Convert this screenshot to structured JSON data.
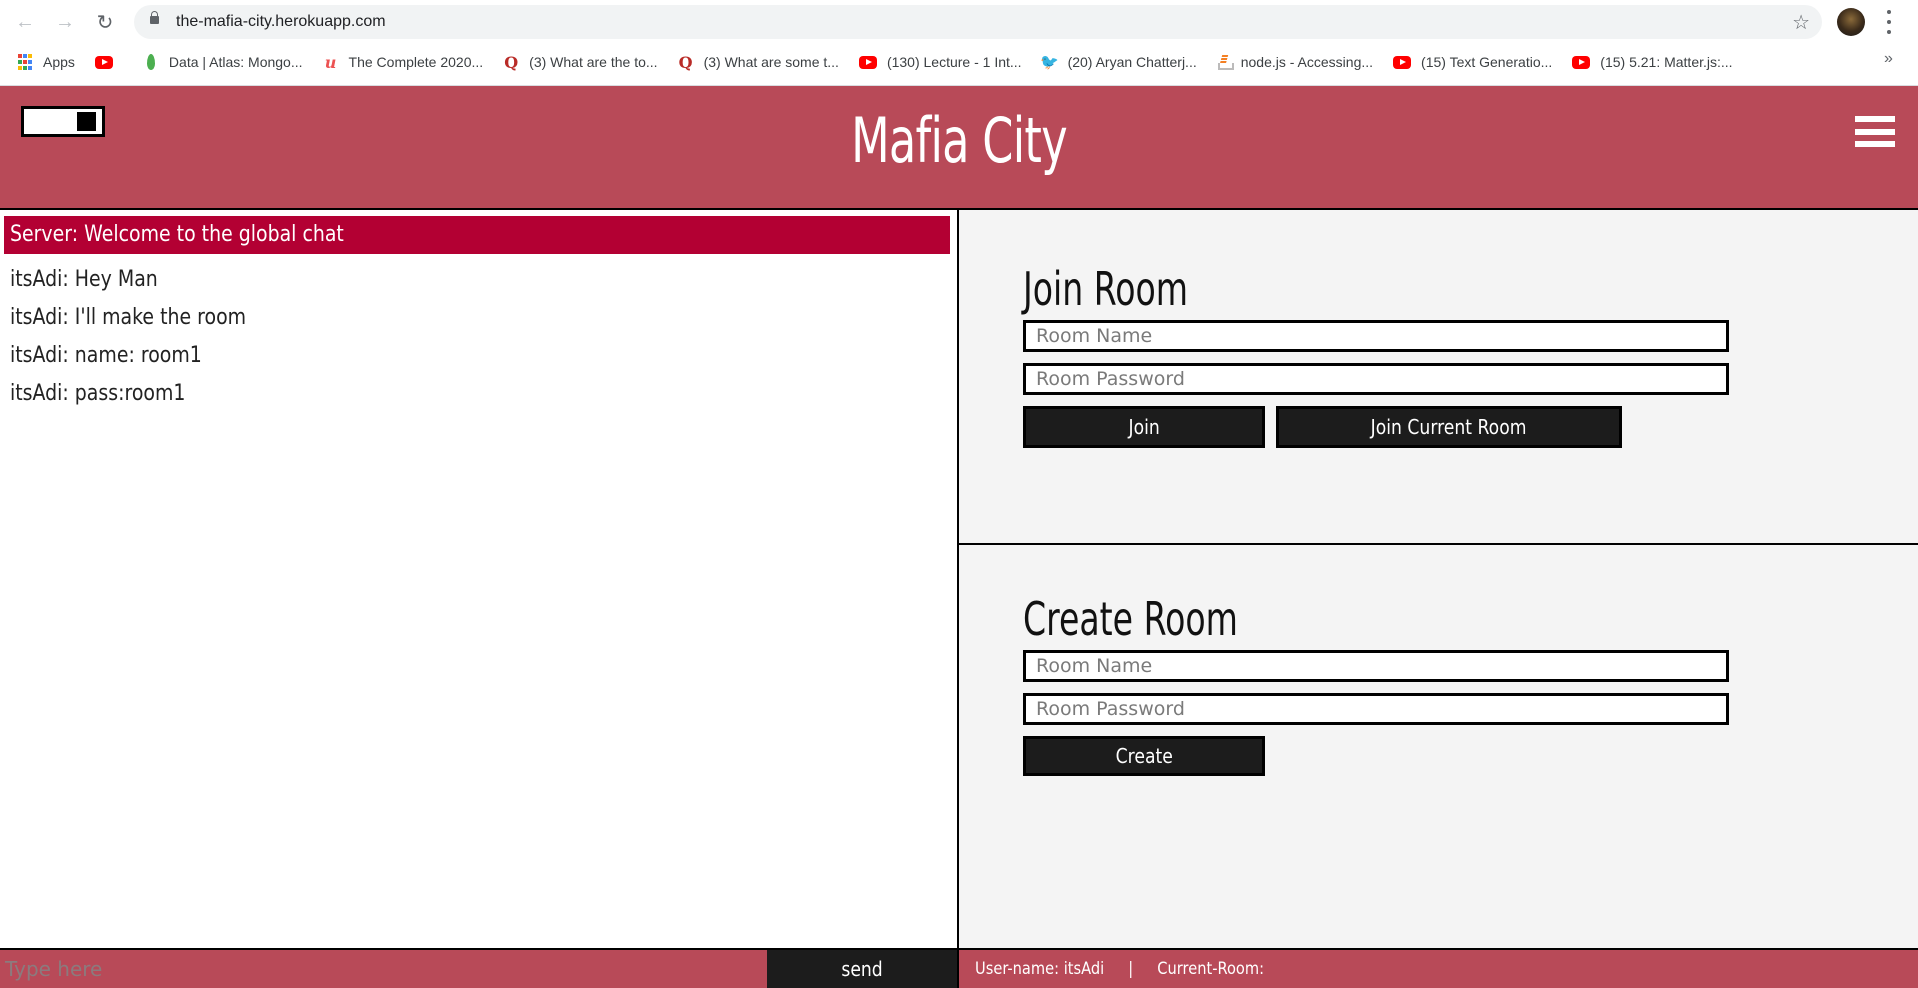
{
  "browser": {
    "url": "the-mafia-city.herokuapp.com",
    "nav": {
      "back_icon": "arrow-left",
      "forward_icon": "arrow-right",
      "reload_icon": "reload"
    },
    "bookmarks": [
      {
        "icon": "apps-grid-icon",
        "label": "Apps"
      },
      {
        "icon": "youtube-icon",
        "label": ""
      },
      {
        "icon": "mongodb-leaf-icon",
        "label": "Data | Atlas: Mongo..."
      },
      {
        "icon": "udemy-icon",
        "label": "The Complete 2020..."
      },
      {
        "icon": "quora-icon",
        "label": "(3) What are the to..."
      },
      {
        "icon": "quora-icon",
        "label": "(3) What are some t..."
      },
      {
        "icon": "youtube-icon",
        "label": "(130) Lecture - 1 Int..."
      },
      {
        "icon": "twitter-icon",
        "label": "(20) Aryan Chatterj..."
      },
      {
        "icon": "stackoverflow-icon",
        "label": "node.js - Accessing..."
      },
      {
        "icon": "youtube-icon",
        "label": "(15) Text Generatio..."
      },
      {
        "icon": "youtube-icon",
        "label": "(15) 5.21: Matter.js:..."
      }
    ],
    "more_bookmarks": "»"
  },
  "header": {
    "title": "Mafia City",
    "theme_toggle_state": "on",
    "menu_icon": "hamburger-icon"
  },
  "chat": {
    "server_message": "Server: Welcome to the global chat",
    "messages": [
      "itsAdi: Hey Man",
      "itsAdi: I'll make the room",
      "itsAdi: name: room1",
      "itsAdi: pass:room1"
    ],
    "input_placeholder": "Type here",
    "input_value": "",
    "send_label": "send"
  },
  "join_room": {
    "heading": "Join Room",
    "name_placeholder": "Room Name",
    "password_placeholder": "Room Password",
    "join_label": "Join",
    "join_current_label": "Join Current Room"
  },
  "create_room": {
    "heading": "Create Room",
    "name_placeholder": "Room Name",
    "password_placeholder": "Room Password",
    "create_label": "Create"
  },
  "status": {
    "username_label": "User-name: itsAdi",
    "separator": "|",
    "current_room_label": "Current-Room:"
  },
  "colors": {
    "brand": "#b84a58",
    "server_message_bg": "#b30033",
    "button_bg": "#1c1c1c",
    "panel_bg": "#f4f4f4"
  }
}
